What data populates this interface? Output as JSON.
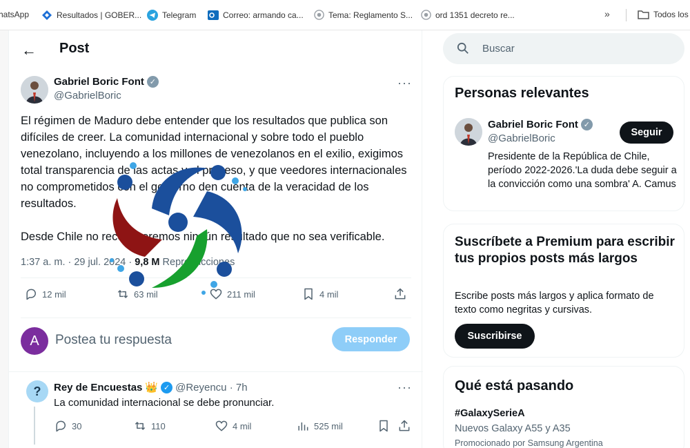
{
  "bookmarks": [
    {
      "label": "hatsApp",
      "icon": "whatsapp-icon",
      "color": "#25d366"
    },
    {
      "label": "Resultados | GOBER...",
      "icon": "diamond-icon",
      "color": "#1d6fd6"
    },
    {
      "label": "Telegram",
      "icon": "telegram-icon",
      "color": "#2aa3df"
    },
    {
      "label": "Correo: armando ca...",
      "icon": "outlook-icon",
      "color": "#0f6cbd"
    },
    {
      "label": "Tema: Reglamento S...",
      "icon": "seal-icon",
      "color": "#9aa0a6"
    },
    {
      "label": "ord 1351 decreto re...",
      "icon": "seal-icon",
      "color": "#9aa0a6"
    }
  ],
  "bookmarks_more": "»",
  "all_bookmarks": "Todos los",
  "header": {
    "title": "Post",
    "back_icon": "←"
  },
  "post": {
    "author": "Gabriel Boric Font",
    "handle": "@GabrielBoric",
    "more_icon": "···",
    "paragraphs": [
      "El régimen de Maduro debe entender que los resultados que publica son difíciles de creer. La comunidad internacional y sobre todo el pueblo venezolano, incluyendo a los millones de venezolanos en el exilio, exigimos total transparencia de las actas y el proceso, y que veedores internacionales no comprometidos con el gobierno den cuenta de la veracidad de los resultados.",
      "Desde Chile no reconoceremos ningún resultado que no sea verificable."
    ],
    "time": "1:37 a. m. · 29 jul. 2024 · ",
    "views": "9,8 M",
    "views_label": " Reproducciones",
    "stats": {
      "replies": "12 mil",
      "reposts": "63 mil",
      "likes": "211 mil",
      "bookmarks": "4 mil"
    }
  },
  "reply_box": {
    "avatar_letter": "A",
    "avatar_color": "#7b2d9e",
    "placeholder": "Postea tu respuesta",
    "button": "Responder"
  },
  "reply": {
    "author": "Rey de Encuestas",
    "crown": "👑",
    "handle_time": "@Reyencu · 7h",
    "avatar_letter": "?",
    "text": "La comunidad internacional se debe pronunciar.",
    "stats": {
      "replies": "30",
      "reposts": "110",
      "likes": "4 mil",
      "views": "525 mil"
    }
  },
  "search": {
    "placeholder": "Buscar"
  },
  "relevant": {
    "title": "Personas relevantes",
    "name": "Gabriel Boric Font",
    "handle": "@GabrielBoric",
    "follow": "Seguir",
    "bio": "Presidente de la República de Chile, período 2022-2026.'La duda debe seguir a la convicción como una sombra' A. Camus"
  },
  "premium": {
    "title": "Suscríbete a Premium para escribir tus propios posts más largos",
    "desc": "Escribe posts más largos y aplica formato de texto como negritas y cursivas.",
    "button": "Suscribirse"
  },
  "trends": {
    "title": "Qué está pasando",
    "tag": "#GalaxySerieA",
    "sub": "Nuevos Galaxy A55 y A35",
    "promo": "Promocionado por Samsung Argentina"
  }
}
